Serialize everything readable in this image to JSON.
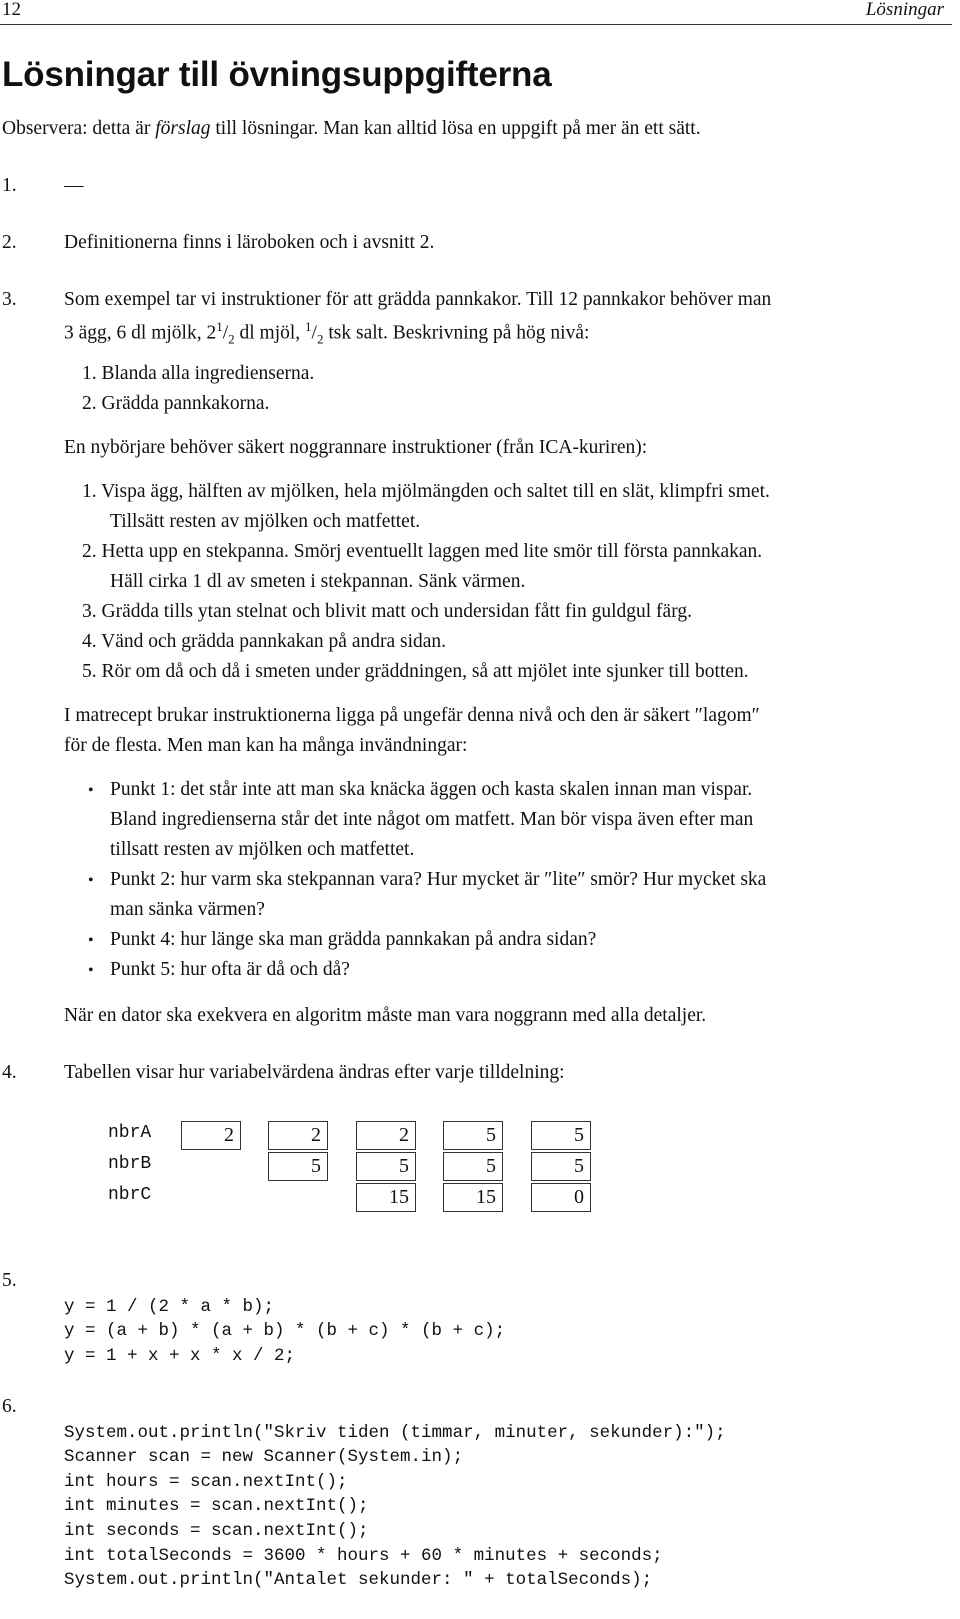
{
  "header": {
    "page_number": "12",
    "running_title": "Lösningar"
  },
  "title": "Lösningar till övningsuppgifterna",
  "intro": {
    "before": "Observera: detta är ",
    "emph": "förslag",
    "after": " till lösningar. Man kan alltid lösa en uppgift på mer än ett sätt."
  },
  "answers": {
    "a1": {
      "number": "1.",
      "text": "—"
    },
    "a2": {
      "number": "2.",
      "text": "Definitionerna finns i läroboken och i avsnitt 2."
    },
    "a3": {
      "number": "3.",
      "line1": "Som exempel tar vi instruktioner för att grädda pannkakor. Till 12 pannkakor behöver man",
      "line2_a": "3 ägg, 6 dl mjölk, 2",
      "frac_num": "1",
      "frac_slash": "/",
      "frac_den": "2",
      "line2_b": " dl mjöl, ",
      "line2_c": " tsk salt. Beskrivning på hög nivå:",
      "high_level": [
        "1. Blanda alla ingredienserna.",
        "2. Grädda pannkakorna."
      ],
      "beginner_intro": "En nybörjare behöver säkert noggrannare instruktioner (från ICA-kuriren):",
      "detailed": [
        "1. Vispa ägg, hälften av mjölken, hela mjölmängden och saltet till en slät, klimpfri smet.",
        "Tillsätt resten av mjölken och matfettet.",
        "2. Hetta upp en stekpanna. Smörj eventuellt laggen med lite smör till första pannkakan.",
        "Häll cirka 1 dl av smeten i stekpannan. Sänk värmen.",
        "3. Grädda tills ytan stelnat och blivit matt och undersidan fått fin guldgul färg.",
        "4. Vänd och grädda pannkakan på andra sidan.",
        "5. Rör om då och då i smeten under gräddningen, så att mjölet inte sjunker till botten."
      ],
      "para1": "I matrecept brukar instruktionerna ligga på ungefär denna nivå och den är säkert ″lagom″",
      "para2": "för de flesta. Men man kan ha många invändningar:",
      "bullet_char": "•",
      "bullets": [
        "Punkt 1: det står inte att man ska knäcka äggen och kasta skalen innan man vispar.",
        "Bland ingredienserna står det inte något om matfett. Man bör vispa även efter man",
        "tillsatt resten av mjölken och matfettet.",
        "Punkt 2: hur varm ska stekpannan vara? Hur mycket är ″lite″ smör? Hur mycket ska",
        "man sänka värmen?",
        "Punkt 4: hur länge ska man grädda pannkakan på andra sidan?",
        "Punkt 5: hur ofta är då och då?"
      ],
      "conclusion": "När en dator ska exekvera en algoritm måste man vara noggrann med alla detaljer."
    },
    "a4": {
      "number": "4.",
      "text": "Tabellen visar hur variabelvärdena ändras efter varje tilldelning:",
      "variables": [
        "nbrA",
        "nbrB",
        "nbrC"
      ],
      "steps": [
        {
          "nbrA": "2"
        },
        {
          "nbrA": "2",
          "nbrB": "5"
        },
        {
          "nbrA": "2",
          "nbrB": "5",
          "nbrC": "15"
        },
        {
          "nbrA": "5",
          "nbrB": "5",
          "nbrC": "15"
        },
        {
          "nbrA": "5",
          "nbrB": "5",
          "nbrC": "0"
        }
      ]
    },
    "a5": {
      "number": "5.",
      "code": [
        "y = 1 / (2 * a * b);",
        "y = (a + b) * (a + b) * (b + c) * (b + c);",
        "y = 1 + x + x * x / 2;"
      ]
    },
    "a6": {
      "number": "6.",
      "code": [
        "System.out.println(\"Skriv tiden (timmar, minuter, sekunder):\");",
        "Scanner scan = new Scanner(System.in);",
        "int hours = scan.nextInt();",
        "int minutes = scan.nextInt();",
        "int seconds = scan.nextInt();",
        "int totalSeconds = 3600 * hours + 60 * minutes + seconds;",
        "System.out.println(\"Antalet sekunder: \" + totalSeconds);"
      ]
    }
  }
}
